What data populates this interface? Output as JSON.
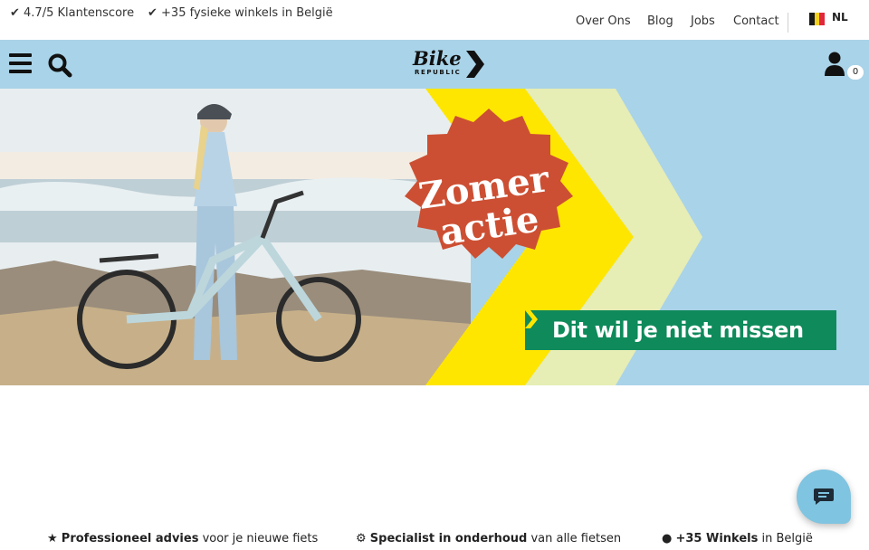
{
  "topbar": {
    "usp_score": "✔ 4.7/5 Klantenscore",
    "usp_stores": "✔ +35 fysieke winkels in België",
    "links": {
      "about": "Over Ons",
      "blog": "Blog",
      "jobs": "Jobs",
      "contact": "Contact"
    },
    "language": "NL",
    "flag_colors": [
      "#1a1a1a",
      "#f5d11f",
      "#e0283a"
    ]
  },
  "navbar": {
    "logo_main": "Bike",
    "logo_sub": "REPUBLIC",
    "cart_count": "0",
    "icons": [
      "menu-icon",
      "search-icon",
      "user-icon"
    ]
  },
  "hero": {
    "badge_line1": "Zomer",
    "badge_line2": "actie",
    "cta_label": "Dit wil je niet missen",
    "colors": {
      "badge": "#cc4f33",
      "arrow_yellow": "#ffe600",
      "arrow_pale": "#e6edb5",
      "cta": "#0f8a5b",
      "sky": "#a9d3e8"
    }
  },
  "usps": [
    {
      "icon": "star-icon",
      "bold": "Professioneel advies",
      "rest": " voor je nieuwe fiets"
    },
    {
      "icon": "bike-icon",
      "bold": "Specialist in onderhoud",
      "rest": " van alle fietsen"
    },
    {
      "icon": "pin-icon",
      "bold": "+35 Winkels",
      "rest": " in België"
    }
  ],
  "chat": {
    "icon": "chat-icon"
  }
}
